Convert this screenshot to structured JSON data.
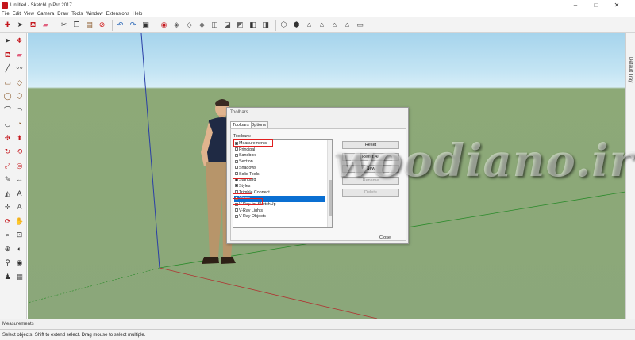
{
  "window": {
    "title": "Untitled - SketchUp Pro 2017",
    "minimize_glyph": "–",
    "maximize_glyph": "□",
    "close_glyph": "✕"
  },
  "menu": [
    "File",
    "Edit",
    "View",
    "Camera",
    "Draw",
    "Tools",
    "Window",
    "Extensions",
    "Help"
  ],
  "toolbar_icons": [
    {
      "name": "getting-started-icon",
      "glyph": "✚",
      "color": "#c4161c"
    },
    {
      "name": "select-icon",
      "glyph": "➤",
      "color": "#333333"
    },
    {
      "name": "paint-bucket-icon",
      "glyph": "⛾",
      "color": "#c4161c"
    },
    {
      "name": "eraser-icon",
      "glyph": "▰",
      "color": "#e0607e"
    },
    {
      "name": "separator"
    },
    {
      "name": "cut-icon",
      "glyph": "✂",
      "color": "#333333"
    },
    {
      "name": "copy-icon",
      "glyph": "❐",
      "color": "#333333"
    },
    {
      "name": "paste-icon",
      "glyph": "▤",
      "color": "#8b5a2b"
    },
    {
      "name": "delete-icon",
      "glyph": "⊘",
      "color": "#d01818"
    },
    {
      "name": "separator"
    },
    {
      "name": "undo-icon",
      "glyph": "↶",
      "color": "#1e5fb4"
    },
    {
      "name": "redo-icon",
      "glyph": "↷",
      "color": "#1e5fb4"
    },
    {
      "name": "print-icon",
      "glyph": "▣",
      "color": "#333333"
    },
    {
      "name": "separator"
    },
    {
      "name": "model-info-icon",
      "glyph": "◉",
      "color": "#c4161c"
    },
    {
      "name": "styles-icon",
      "glyph": "◈",
      "color": "#555555"
    },
    {
      "name": "xray-icon",
      "glyph": "◇",
      "color": "#555555"
    },
    {
      "name": "back-edges-icon",
      "glyph": "◆",
      "color": "#777777"
    },
    {
      "name": "wireframe-icon",
      "glyph": "◫",
      "color": "#555555"
    },
    {
      "name": "hidden-line-icon",
      "glyph": "◪",
      "color": "#555555"
    },
    {
      "name": "shaded-icon",
      "glyph": "◩",
      "color": "#666666"
    },
    {
      "name": "shaded-textures-icon",
      "glyph": "◧",
      "color": "#333333"
    },
    {
      "name": "monochrome-icon",
      "glyph": "◨",
      "color": "#444444"
    },
    {
      "name": "separator"
    },
    {
      "name": "iso-view-icon",
      "glyph": "⬡",
      "color": "#555555"
    },
    {
      "name": "top-view-icon",
      "glyph": "⬢",
      "color": "#333333"
    },
    {
      "name": "front-view-icon",
      "glyph": "⌂",
      "color": "#333333"
    },
    {
      "name": "right-view-icon",
      "glyph": "⌂",
      "color": "#333333"
    },
    {
      "name": "back-view-icon",
      "glyph": "⌂",
      "color": "#333333"
    },
    {
      "name": "left-view-icon",
      "glyph": "⌂",
      "color": "#333333"
    },
    {
      "name": "bottom-view-icon",
      "glyph": "▭",
      "color": "#555555"
    }
  ],
  "left_tools": [
    [
      "select-tool-icon",
      "➤",
      "#333333"
    ],
    [
      "make-component-icon",
      "❖",
      "#c4161c"
    ],
    [
      "paint-tool-icon",
      "⛾",
      "#c4161c"
    ],
    [
      "eraser-tool-icon",
      "▰",
      "#e0607e"
    ],
    [
      "line-tool-icon",
      "╱",
      "#333333"
    ],
    [
      "freehand-tool-icon",
      "〰",
      "#333333"
    ],
    [
      "rectangle-tool-icon",
      "▭",
      "#8b5a2b"
    ],
    [
      "rotated-rect-tool-icon",
      "◇",
      "#8b5a2b"
    ],
    [
      "circle-tool-icon",
      "◯",
      "#8b5a2b"
    ],
    [
      "polygon-tool-icon",
      "⬡",
      "#8b5a2b"
    ],
    [
      "arc-tool-icon",
      "⌒",
      "#333333"
    ],
    [
      "two-point-arc-icon",
      "◠",
      "#333333"
    ],
    [
      "three-point-arc-icon",
      "◡",
      "#333333"
    ],
    [
      "pie-tool-icon",
      "◔",
      "#8b5a2b"
    ],
    [
      "move-tool-icon",
      "✥",
      "#c4161c"
    ],
    [
      "push-pull-tool-icon",
      "⬆",
      "#c4161c"
    ],
    [
      "rotate-tool-icon",
      "↻",
      "#c4161c"
    ],
    [
      "follow-me-icon",
      "⟲",
      "#c4161c"
    ],
    [
      "scale-tool-icon",
      "⤢",
      "#c4161c"
    ],
    [
      "offset-tool-icon",
      "◎",
      "#c4161c"
    ],
    [
      "tape-measure-icon",
      "✎",
      "#555555"
    ],
    [
      "dimension-tool-icon",
      "↔",
      "#555555"
    ],
    [
      "protractor-icon",
      "◭",
      "#555555"
    ],
    [
      "text-tool-icon",
      "A",
      "#333333"
    ],
    [
      "axes-tool-icon",
      "✛",
      "#555555"
    ],
    [
      "3d-text-icon",
      "A",
      "#555555"
    ],
    [
      "orbit-tool-icon",
      "⟳",
      "#c4161c"
    ],
    [
      "pan-tool-icon",
      "✋",
      "#333333"
    ],
    [
      "zoom-tool-icon",
      "⌕",
      "#333333"
    ],
    [
      "zoom-window-icon",
      "⊡",
      "#333333"
    ],
    [
      "zoom-extents-icon",
      "⊕",
      "#333333"
    ],
    [
      "previous-view-icon",
      "◐",
      "#333333"
    ],
    [
      "position-camera-icon",
      "⚲",
      "#333333"
    ],
    [
      "look-around-icon",
      "◉",
      "#333333"
    ],
    [
      "walk-tool-icon",
      "♟",
      "#333333"
    ],
    [
      "section-plane-icon",
      "▦",
      "#555555"
    ]
  ],
  "tray": {
    "title": "Default Tray"
  },
  "dialog": {
    "title": "Toolbars",
    "tabs": [
      "Toolbars",
      "Options"
    ],
    "list_label": "Toolbars:",
    "items": [
      {
        "label": "Measurements",
        "checked": true
      },
      {
        "label": "Principal",
        "checked": false
      },
      {
        "label": "Sandbox",
        "checked": false
      },
      {
        "label": "Section",
        "checked": false
      },
      {
        "label": "Shadows",
        "checked": false
      },
      {
        "label": "Solid Tools",
        "checked": false
      },
      {
        "label": "Standard",
        "checked": true
      },
      {
        "label": "Styles",
        "checked": true
      },
      {
        "label": "Trimble Connect",
        "checked": false
      },
      {
        "label": "Views",
        "checked": true,
        "selected": true
      },
      {
        "label": "V-Ray for SketchUp",
        "checked": false
      },
      {
        "label": "V-Ray Lights",
        "checked": false
      },
      {
        "label": "V-Ray Objects",
        "checked": false
      }
    ],
    "buttons": {
      "reset": "Reset",
      "reset_all": "Reset All",
      "new": "New",
      "rename": "Rename",
      "delete": "Delete",
      "close": "Close"
    }
  },
  "watermark": "woodiano.ir",
  "measurements": {
    "label": "Measurements"
  },
  "status": {
    "text": "Select objects. Shift to extend select. Drag mouse to select multiple."
  },
  "colors": {
    "sky": "#c5e5f4",
    "ground": "#8ba77a",
    "highlight_box": "#e02020",
    "selection": "#0a6fd2"
  }
}
